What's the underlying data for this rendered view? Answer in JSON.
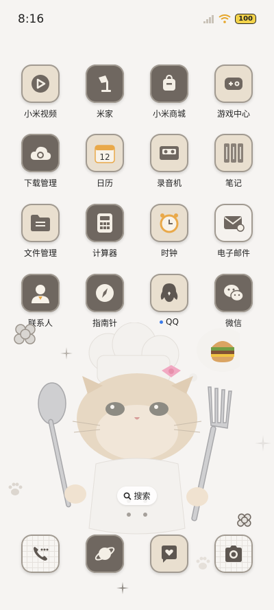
{
  "status_bar": {
    "time": "8:16",
    "battery": "100"
  },
  "apps": [
    {
      "label": "小米视频"
    },
    {
      "label": "米家"
    },
    {
      "label": "小米商城"
    },
    {
      "label": "游戏中心"
    },
    {
      "label": "下载管理"
    },
    {
      "label": "日历"
    },
    {
      "label": "录音机"
    },
    {
      "label": "笔记"
    },
    {
      "label": "文件管理"
    },
    {
      "label": "计算器"
    },
    {
      "label": "时钟"
    },
    {
      "label": "电子邮件"
    },
    {
      "label": "联系人"
    },
    {
      "label": "指南针"
    },
    {
      "label": "QQ"
    },
    {
      "label": "微信"
    }
  ],
  "calendar_day": "12",
  "search": {
    "label": "搜索"
  }
}
